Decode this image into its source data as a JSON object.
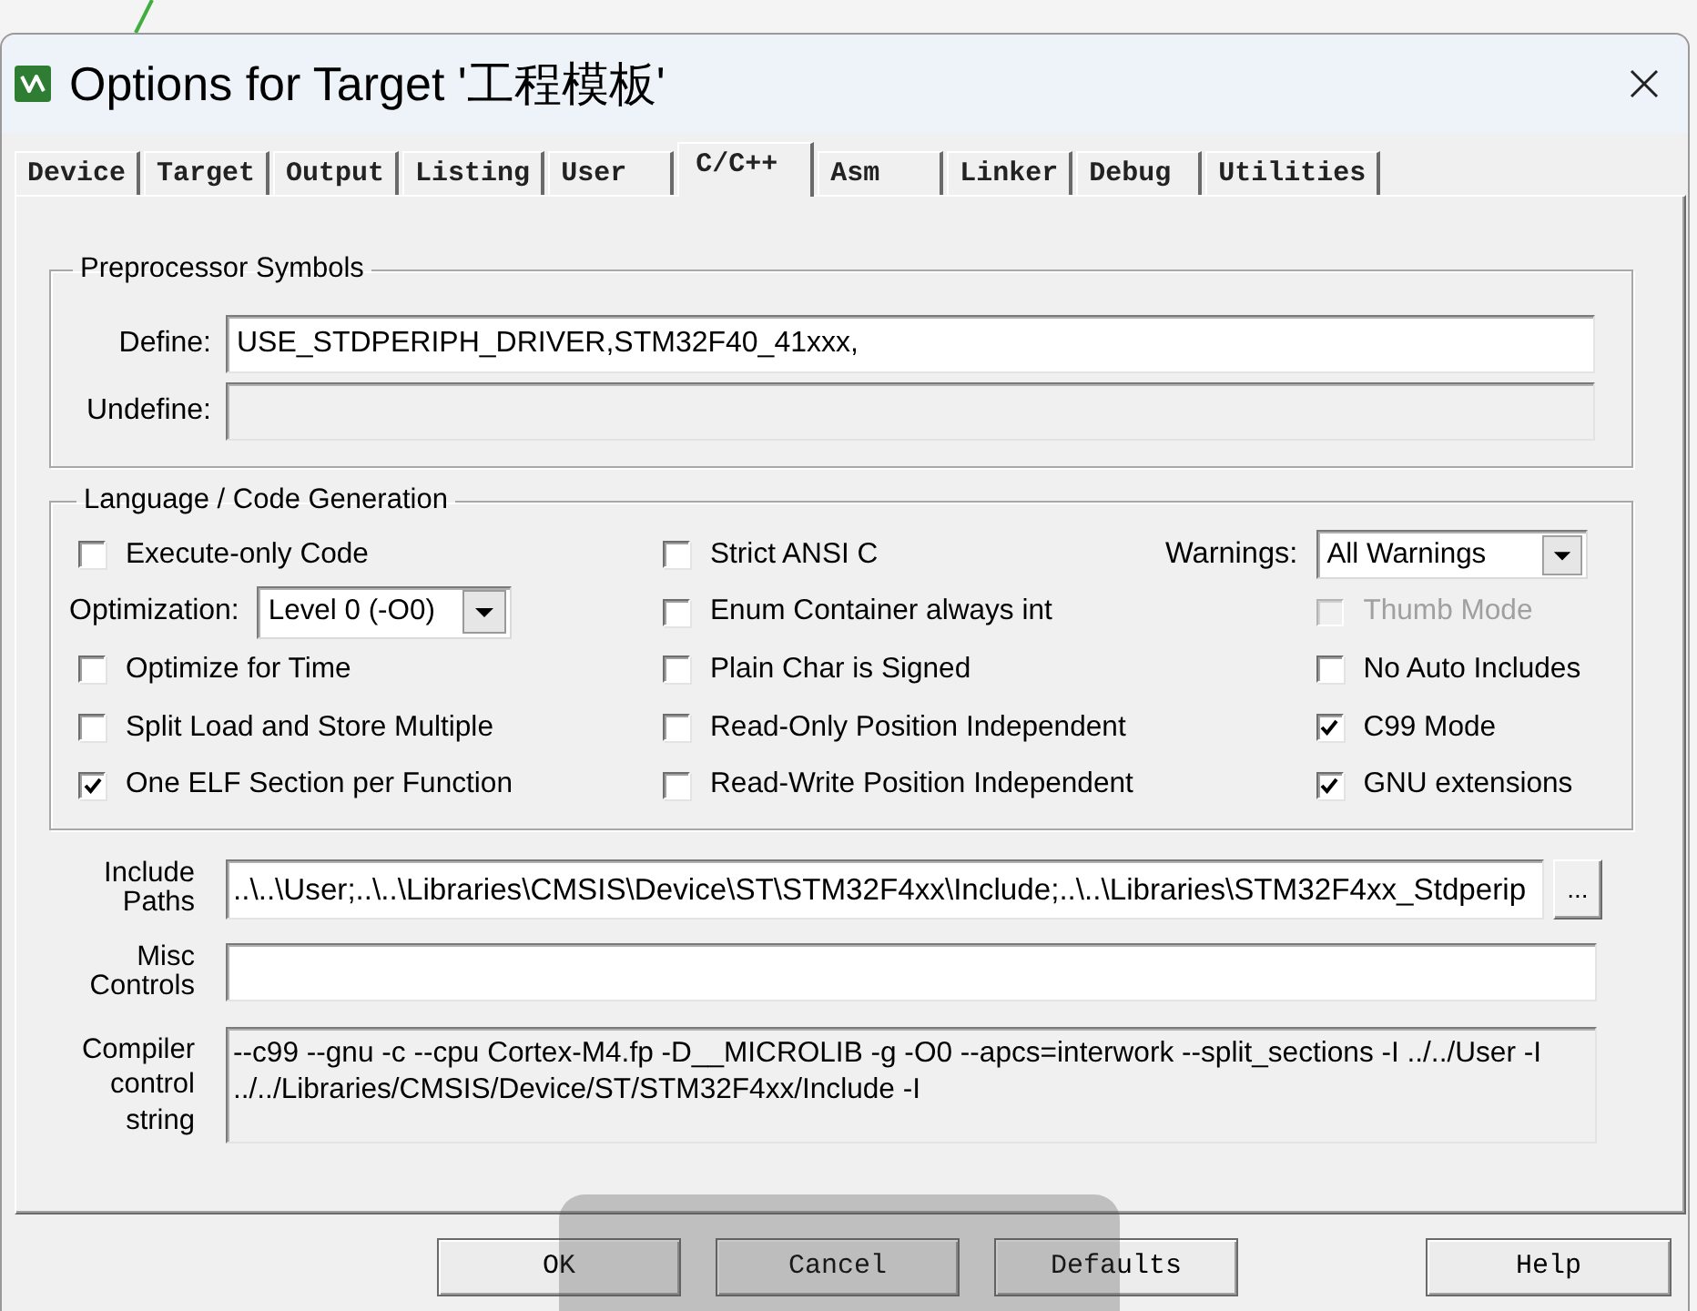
{
  "window": {
    "title": "Options for Target '工程模板'"
  },
  "tabs": [
    {
      "label": "Device",
      "selected": false
    },
    {
      "label": "Target",
      "selected": false
    },
    {
      "label": "Output",
      "selected": false
    },
    {
      "label": "Listing",
      "selected": false
    },
    {
      "label": "User",
      "selected": false
    },
    {
      "label": "C/C++",
      "selected": true
    },
    {
      "label": "Asm",
      "selected": false
    },
    {
      "label": "Linker",
      "selected": false
    },
    {
      "label": "Debug",
      "selected": false
    },
    {
      "label": "Utilities",
      "selected": false
    }
  ],
  "preprocessor_symbols": {
    "title": "Preprocessor Symbols",
    "fields": [
      {
        "label": "Define:",
        "value": "USE_STDPERIPH_DRIVER,STM32F40_41xxx,",
        "disabled": false
      },
      {
        "label": "Undefine:",
        "disabled": true
      }
    ]
  },
  "language": {
    "title": "Language / Code Generation",
    "columns": [
      {
        "items": [
          {
            "kind": "checkbox",
            "label": "Execute-only Code",
            "checked": false,
            "disabled": false
          },
          {
            "kind": "select",
            "label": "Optimization:",
            "value": "Level 0 (-O0)"
          },
          {
            "kind": "checkbox",
            "label": "Optimize for Time",
            "checked": false,
            "disabled": false
          },
          {
            "kind": "checkbox",
            "label": "Split Load and Store Multiple",
            "checked": false,
            "disabled": false
          },
          {
            "kind": "checkbox",
            "label": "One ELF Section per Function",
            "checked": true,
            "disabled": false
          }
        ]
      },
      {
        "items": [
          {
            "kind": "checkbox",
            "label": "Strict ANSI C",
            "checked": false,
            "disabled": false
          },
          {
            "kind": "checkbox",
            "label": "Enum Container always int",
            "checked": false,
            "disabled": false
          },
          {
            "kind": "checkbox",
            "label": "Plain Char is Signed",
            "checked": false,
            "disabled": false
          },
          {
            "kind": "checkbox",
            "label": "Read-Only Position Independent",
            "checked": false,
            "disabled": false
          },
          {
            "kind": "checkbox",
            "label": "Read-Write Position Independent",
            "checked": false,
            "disabled": false
          }
        ]
      },
      {
        "items": [
          {
            "kind": "select",
            "label": "Warnings:",
            "value": "All Warnings"
          },
          {
            "kind": "checkbox",
            "label": "Thumb Mode",
            "checked": false,
            "disabled": true
          },
          {
            "kind": "checkbox",
            "label": "No Auto Includes",
            "checked": false,
            "disabled": false
          },
          {
            "kind": "checkbox",
            "label": "C99 Mode",
            "checked": true,
            "disabled": false
          },
          {
            "kind": "checkbox",
            "label": "GNU extensions",
            "checked": true,
            "disabled": false
          }
        ]
      }
    ]
  },
  "include_paths": {
    "label": "Include Paths",
    "value": "..\\..\\User;..\\..\\Libraries\\CMSIS\\Device\\ST\\STM32F4xx\\Include;..\\..\\Libraries\\STM32F4xx_Stdperip",
    "browse_button": "..."
  },
  "misc_controls": {
    "label": "Misc Controls"
  },
  "compiler_control_string": {
    "label": "Compiler control string",
    "value": "--c99 --gnu -c --cpu Cortex-M4.fp -D__MICROLIB -g -O0 --apcs=interwork --split_sections -I ../../User -I ../../Libraries/CMSIS/Device/ST/STM32F4xx/Include -I"
  },
  "buttons": [
    "OK",
    "Cancel",
    "Defaults",
    "Help"
  ]
}
